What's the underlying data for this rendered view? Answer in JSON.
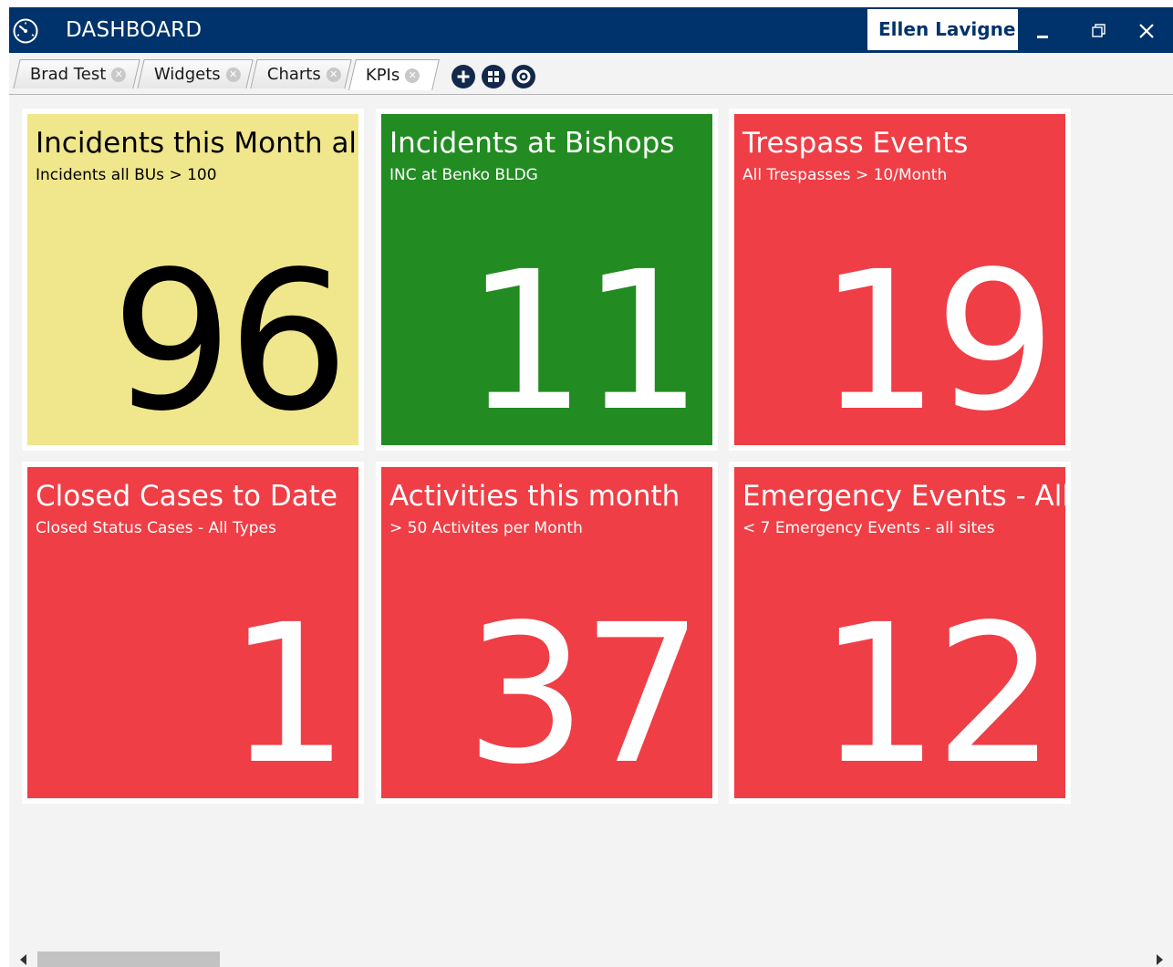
{
  "window": {
    "title": "DASHBOARD",
    "user_name": "Ellen Lavigne",
    "title_bar_color": "#00336b"
  },
  "tabs": [
    {
      "label": "Brad Test",
      "active": false
    },
    {
      "label": "Widgets",
      "active": false
    },
    {
      "label": "Charts",
      "active": false
    },
    {
      "label": "KPIs",
      "active": true
    }
  ],
  "toolbar": {
    "buttons": [
      "add-icon",
      "layout-icon",
      "settings-icon"
    ]
  },
  "tiles": [
    {
      "title": "Incidents this Month all",
      "subtitle": "Incidents all BUs > 100",
      "value": "96",
      "background": "#f0e68c",
      "text_color": "#000000"
    },
    {
      "title": "Incidents at Bishops",
      "subtitle": "INC at Benko BLDG",
      "value": "11",
      "background": "#228b22",
      "text_color": "#ffffff"
    },
    {
      "title": "Trespass Events",
      "subtitle": "All Trespasses > 10/Month",
      "value": "19",
      "background": "#ef3e46",
      "text_color": "#ffffff"
    },
    {
      "title": "Closed Cases to Date",
      "subtitle": "Closed Status Cases - All Types",
      "value": "1",
      "background": "#ef3e46",
      "text_color": "#ffffff"
    },
    {
      "title": "Activities this month",
      "subtitle": "> 50 Activites per Month",
      "value": "37",
      "background": "#ef3e46",
      "text_color": "#ffffff"
    },
    {
      "title": "Emergency Events - All",
      "subtitle": "< 7 Emergency Events - all sites",
      "value": "12",
      "background": "#ef3e46",
      "text_color": "#ffffff"
    }
  ]
}
